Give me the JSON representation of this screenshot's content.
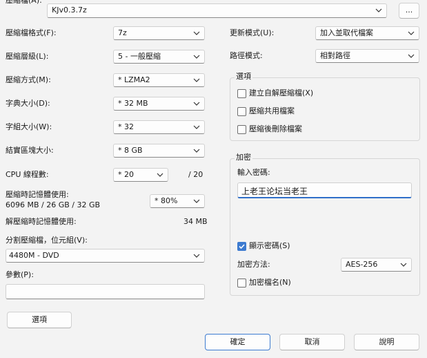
{
  "archive": {
    "label": "壓縮檔(A):",
    "path": "KJv0.3.7z",
    "browse_label": "..."
  },
  "left": {
    "format": {
      "label": "壓縮檔格式(F):",
      "value": "7z"
    },
    "level": {
      "label": "壓縮層級(L):",
      "value": "5 - 一般壓縮"
    },
    "method": {
      "label": "壓縮方式(M):",
      "value": "* LZMA2"
    },
    "dict": {
      "label": "字典大小(D):",
      "value": "* 32 MB"
    },
    "word": {
      "label": "字組大小(W):",
      "value": "* 32"
    },
    "solid": {
      "label": "結實區塊大小:",
      "value": "* 8 GB"
    },
    "cpu": {
      "label": "CPU 線程數:",
      "value": "* 20",
      "max": "/ 20"
    },
    "mem": {
      "label": "壓縮時記憶體使用:",
      "detail": "6096 MB / 26 GB / 32 GB",
      "value": "* 80%"
    },
    "decomp": {
      "label": "解壓縮時記憶體使用:",
      "value": "34 MB"
    },
    "split": {
      "label": "分割壓縮檔，位元組(V):",
      "value": "4480M - DVD"
    },
    "params": {
      "label": "參數(P):",
      "value": ""
    },
    "options_button": "選項"
  },
  "right": {
    "update": {
      "label": "更新模式(U):",
      "value": "加入並取代檔案"
    },
    "path": {
      "label": "路徑模式:",
      "value": "相對路徑"
    },
    "options_group": {
      "title": "選項",
      "sfx": {
        "label": "建立自解壓縮檔(X)",
        "checked": false
      },
      "shared": {
        "label": "壓縮共用檔案",
        "checked": false
      },
      "delete": {
        "label": "壓縮後刪除檔案",
        "checked": false
      }
    },
    "encryption": {
      "title": "加密",
      "password_label": "輸入密碼:",
      "password_value": "上老王论坛当老王",
      "show_password": {
        "label": "顯示密碼(S)",
        "checked": true
      },
      "method_label": "加密方法:",
      "method_value": "AES-256",
      "encrypt_names": {
        "label": "加密檔名(N)",
        "checked": false
      }
    }
  },
  "footer": {
    "ok": "確定",
    "cancel": "取消",
    "help": "說明"
  },
  "colors": {
    "accent": "#3d7bd0",
    "background": "#f3f3f3"
  }
}
